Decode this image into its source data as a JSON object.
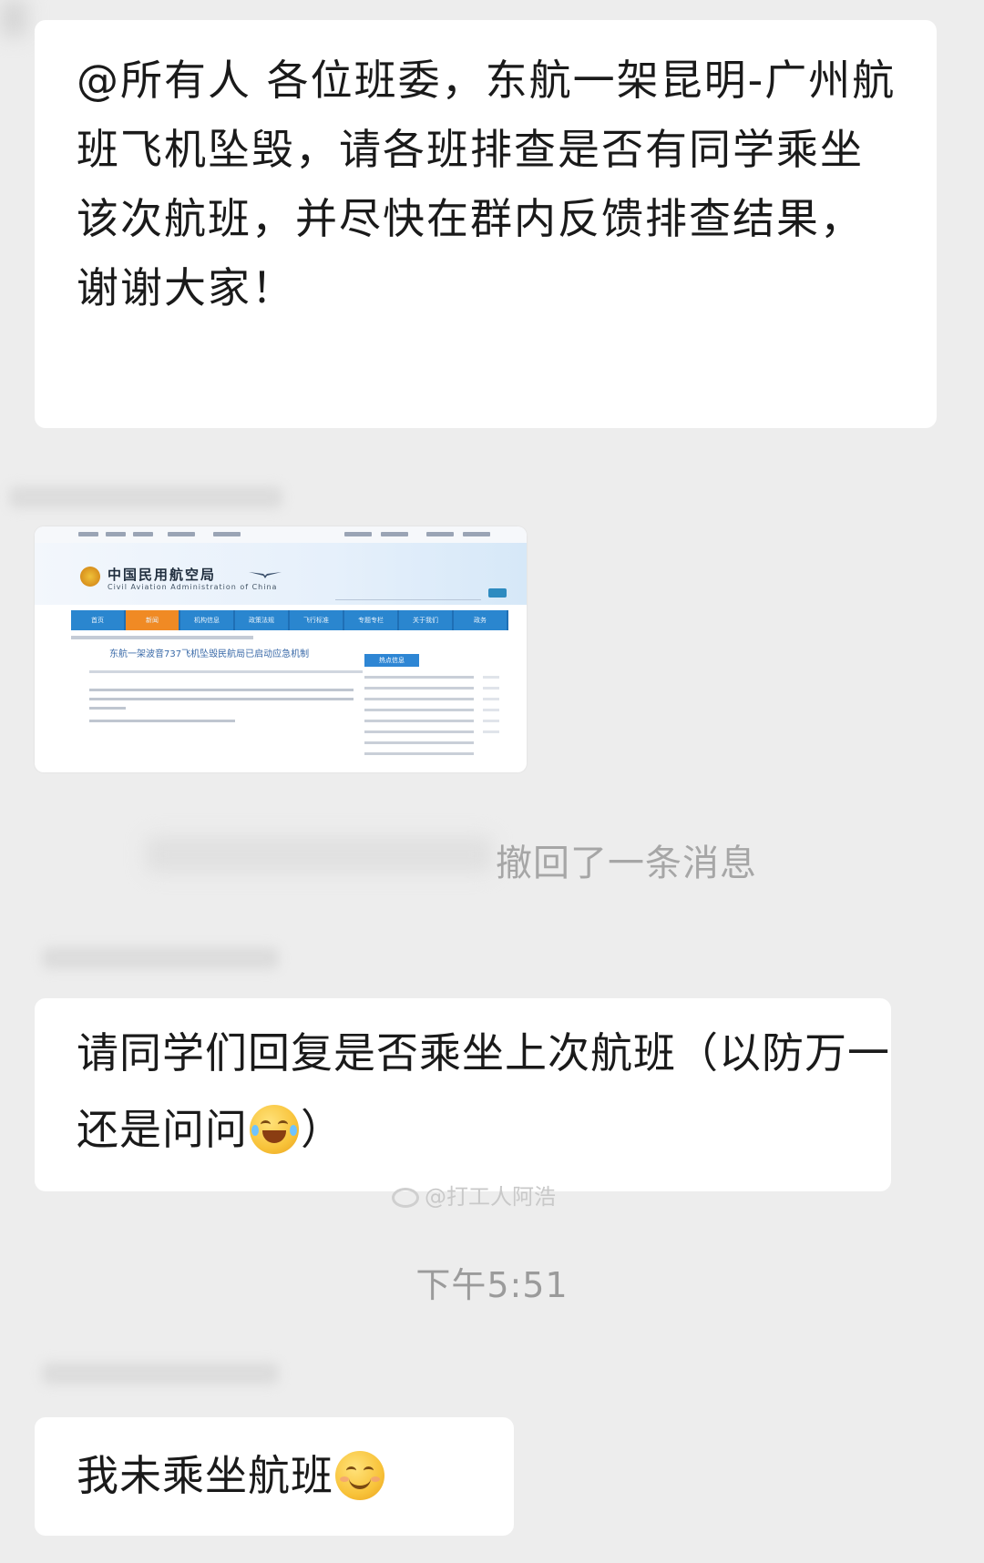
{
  "messages": [
    {
      "id": "msg1",
      "text": "@所有人  各位班委，东航一架昆明-广州航班飞机坠毁，请各班排查是否有同学乘坐该次航班，并尽快在群内反馈排查结果，谢谢大家！"
    },
    {
      "id": "msg2",
      "text_part1": "请同学们回复是否乘坐上次航班（以防万一还是问问",
      "emoji": "tears-of-joy-emoji",
      "text_part2": "）"
    },
    {
      "id": "msg3",
      "text": "我未乘坐航班",
      "emoji": "smiling-face-emoji"
    }
  ],
  "shared_screenshot": {
    "site_title_cn": "中国民用航空局",
    "site_title_en": "Civil Aviation Administration of China",
    "nav_items": [
      "首页",
      "新闻",
      "机构信息",
      "政策法规",
      "飞行标准",
      "专题专栏",
      "关于我们",
      "政务"
    ],
    "article_title": "东航一架波音737飞机坠毁民航局已启动应急机制",
    "side_header": "热点信息"
  },
  "recall_notice": "撤回了一条消息",
  "watermark": "@打工人阿浩",
  "timestamp": "下午5:51",
  "colors": {
    "background": "#ededed",
    "bubble": "#ffffff",
    "nav_blue": "#2a86cf",
    "nav_active": "#f08a24"
  }
}
